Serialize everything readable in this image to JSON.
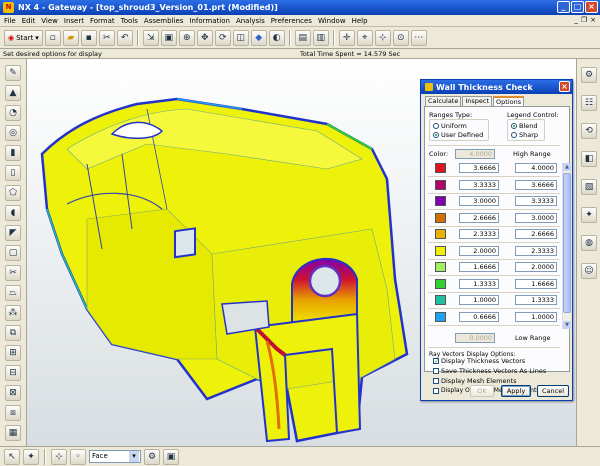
{
  "window": {
    "title": "NX 4 - Gateway - [top_shroud3_Version_01.prt (Modified)]"
  },
  "menu": [
    "File",
    "Edit",
    "View",
    "Insert",
    "Format",
    "Tools",
    "Assemblies",
    "Information",
    "Analysis",
    "Preferences",
    "Window",
    "Help"
  ],
  "toolbar": {
    "start_label": "Start"
  },
  "status": {
    "prompt": "Set desired options for display",
    "time": "Total Time Spent = 14.579 Sec"
  },
  "dialog": {
    "title": "Wall Thickness Check",
    "tabs": [
      "Calculate",
      "Inspect",
      "Options"
    ],
    "active_tab": "Options",
    "ranges_type_label": "Ranges Type:",
    "ranges_options": [
      "Uniform",
      "User Defined"
    ],
    "legend_control_label": "Legend Control:",
    "legend_options": [
      "Blend",
      "Sharp"
    ],
    "color_label": "Color:",
    "color_value": "4.0000",
    "high_range_label": "High Range",
    "low_range_label": "Low Range",
    "low_value": "0.0000",
    "rows": [
      {
        "color": "#e0141b",
        "low": "3.6666",
        "high": "4.0000"
      },
      {
        "color": "#b0006a",
        "low": "3.3333",
        "high": "3.6666"
      },
      {
        "color": "#8000b0",
        "low": "3.0000",
        "high": "3.3333"
      },
      {
        "color": "#d07000",
        "low": "2.6666",
        "high": "3.0000"
      },
      {
        "color": "#e8b000",
        "low": "2.3333",
        "high": "2.6666"
      },
      {
        "color": "#f0f000",
        "low": "2.0000",
        "high": "2.3333"
      },
      {
        "color": "#a0f060",
        "low": "1.6666",
        "high": "2.0000"
      },
      {
        "color": "#30d030",
        "low": "1.3333",
        "high": "1.6666"
      },
      {
        "color": "#20c0a0",
        "low": "1.0000",
        "high": "1.3333"
      },
      {
        "color": "#20a0f0",
        "low": "0.6666",
        "high": "1.0000"
      }
    ],
    "ray_label": "Ray Vectors Display Options:",
    "checks": [
      {
        "label": "Display Thickness Vectors",
        "checked": "✓"
      },
      {
        "label": "Save Thickness Vectors As Lines",
        "checked": ""
      },
      {
        "label": "Display Mesh Elements",
        "checked": ""
      },
      {
        "label": "Display Opposite Mesh Elements",
        "checked": ""
      }
    ],
    "ok_label": "OK",
    "apply_label": "Apply",
    "cancel_label": "Cancel"
  },
  "bottom": {
    "filter_value": "Face"
  }
}
